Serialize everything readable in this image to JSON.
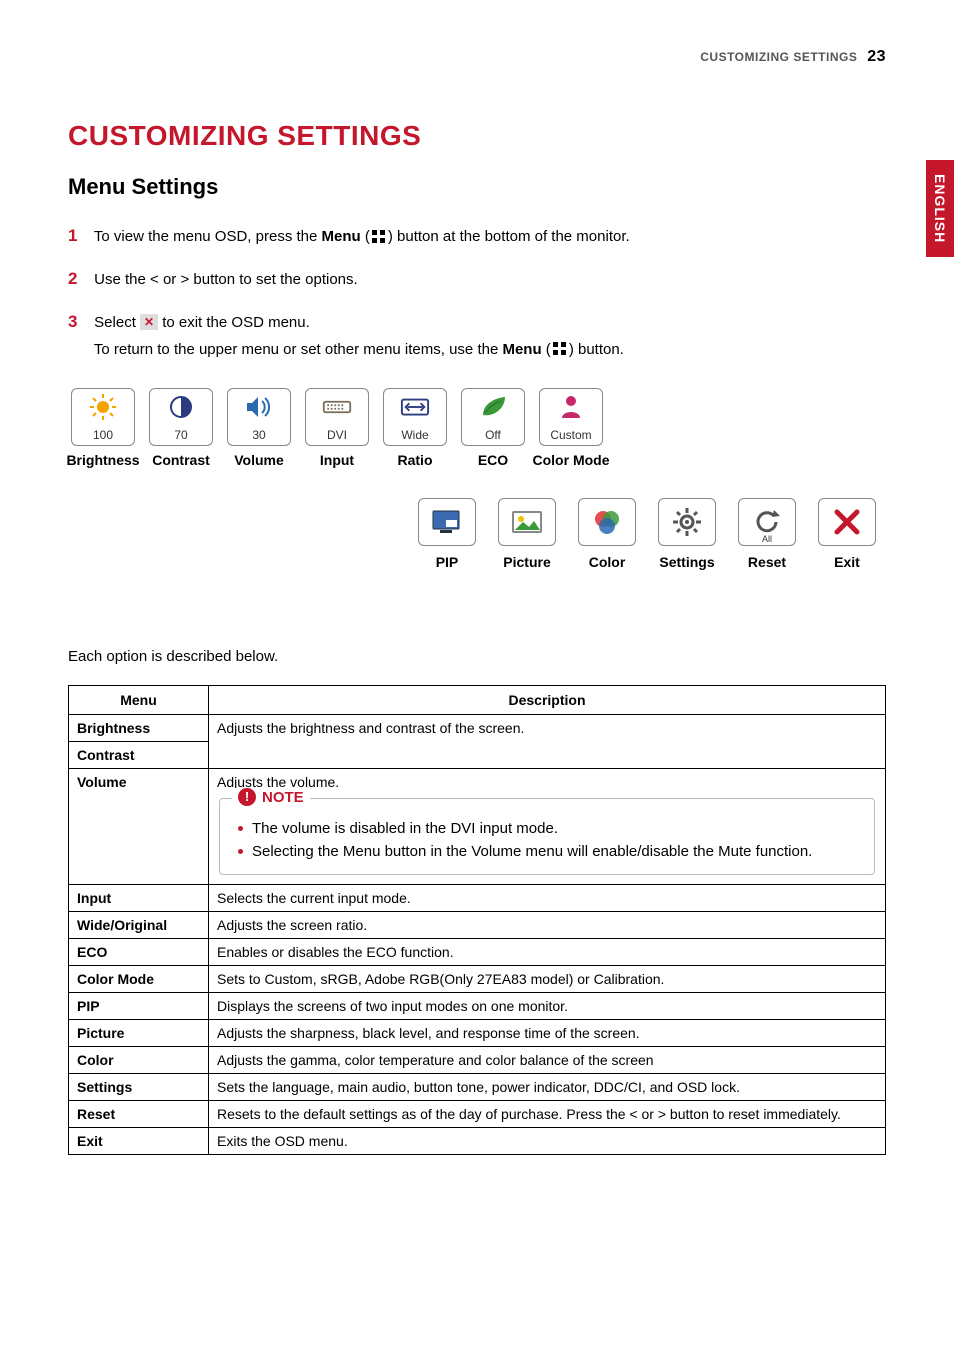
{
  "header": {
    "running_title": "CUSTOMIZING SETTINGS",
    "page_number": "23",
    "language_tab": "ENGLISH"
  },
  "title": "CUSTOMIZING SETTINGS",
  "subtitle": "Menu Settings",
  "steps": {
    "n1": "1",
    "s1a": "To view the menu OSD, press the ",
    "s1b": "Menu",
    "s1c": " (",
    "s1d": ") button at the bottom of the monitor.",
    "n2": "2",
    "s2": "Use the < or > button to set the options.",
    "n3": "3",
    "s3a": "Select ",
    "s3b": " to exit the OSD menu.",
    "s3c": "To return to the upper menu or set other menu items, use the ",
    "s3d": "Menu",
    "s3e": " (",
    "s3f": ") button."
  },
  "tiles_row1": [
    {
      "label": "Brightness",
      "value": "100"
    },
    {
      "label": "Contrast",
      "value": "70"
    },
    {
      "label": "Volume",
      "value": "30"
    },
    {
      "label": "Input",
      "value": "DVI"
    },
    {
      "label": "Ratio",
      "value": "Wide"
    },
    {
      "label": "ECO",
      "value": "Off"
    },
    {
      "label": "Color Mode",
      "value": "Custom"
    }
  ],
  "tiles_row2": [
    {
      "label": "PIP",
      "sublabel": ""
    },
    {
      "label": "Picture",
      "sublabel": ""
    },
    {
      "label": "Color",
      "sublabel": ""
    },
    {
      "label": "Settings",
      "sublabel": ""
    },
    {
      "label": "Reset",
      "sublabel": "All"
    },
    {
      "label": "Exit",
      "sublabel": ""
    }
  ],
  "opts_intro": "Each option is described below.",
  "table": {
    "head_menu": "Menu",
    "head_desc": "Description",
    "brightness": "Brightness",
    "contrast": "Contrast",
    "bright_contrast_desc": "Adjusts the brightness and contrast of the screen.",
    "volume": "Volume",
    "volume_desc": "Adjusts the volume.",
    "note_title": "NOTE",
    "note_items": [
      "The volume is disabled in the DVI input mode.",
      "Selecting the Menu button in the Volume menu will enable/disable the Mute function."
    ],
    "rows": [
      {
        "m": "Input",
        "d": "Selects the current input mode."
      },
      {
        "m": "Wide/Original",
        "d": "Adjusts the screen ratio."
      },
      {
        "m": "ECO",
        "d": "Enables or disables the ECO function."
      },
      {
        "m": "Color Mode",
        "d": "Sets to Custom, sRGB, Adobe RGB(Only 27EA83 model) or Calibration."
      },
      {
        "m": "PIP",
        "d": "Displays the screens of two input modes on one monitor."
      },
      {
        "m": "Picture",
        "d": "Adjusts the sharpness, black level, and response time of the screen."
      },
      {
        "m": "Color",
        "d": "Adjusts the gamma, color temperature and color balance of the screen"
      },
      {
        "m": "Settings",
        "d": "Sets the language, main audio, button tone, power indicator, DDC/CI, and OSD lock."
      },
      {
        "m": "Reset",
        "d": "Resets to the default settings as of the day of purchase. Press the < or > button to reset immediately."
      },
      {
        "m": "Exit",
        "d": "Exits the OSD menu."
      }
    ]
  }
}
